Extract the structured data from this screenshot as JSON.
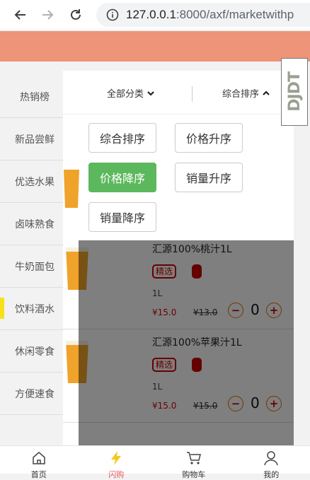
{
  "browser": {
    "url_host": "127.0.0.1",
    "url_rest": ":8000/axf/marketwithp"
  },
  "sidebar": {
    "items": [
      {
        "label": "热销榜"
      },
      {
        "label": "新品尝鲜"
      },
      {
        "label": "优选水果"
      },
      {
        "label": "卤味熟食"
      },
      {
        "label": "牛奶面包"
      },
      {
        "label": "饮料酒水"
      },
      {
        "label": "休闲零食"
      },
      {
        "label": "方便速食"
      }
    ],
    "active_index": 5
  },
  "sort_bar": {
    "category_label": "全部分类",
    "sort_label": "综合排序"
  },
  "sort_options": {
    "comprehensive": "综合排序",
    "price_asc": "价格升序",
    "price_desc": "价格降序",
    "sales_asc": "销量升序",
    "sales_desc": "销量降序",
    "selected": "价格降序"
  },
  "products": [
    {
      "name": "汇源100%桃汁1L",
      "tag": "精选",
      "spec": "1L",
      "price": "¥15.0",
      "market_price": "¥13.0",
      "qty": "0"
    },
    {
      "name": "汇源100%苹果汁1L",
      "tag": "精选",
      "spec": "1L",
      "price": "¥15.0",
      "market_price": "¥15.0",
      "qty": "0"
    }
  ],
  "watermark": "DJDT",
  "bottom_nav": {
    "home": "首页",
    "flash": "闪购",
    "cart": "购物车",
    "mine": "我的"
  },
  "colors": {
    "header": "#ee9479",
    "active_option": "#5cb85c",
    "active_sidebar_marker": "#f6e11b",
    "price": "#dd0000",
    "flash_icon": "#f6c81b"
  },
  "icons": {
    "back": "back-arrow-icon",
    "forward": "forward-arrow-icon",
    "reload": "reload-icon",
    "info": "info-icon",
    "home": "house-icon",
    "flash": "lightning-icon",
    "cart": "cart-icon",
    "mine": "person-icon"
  }
}
